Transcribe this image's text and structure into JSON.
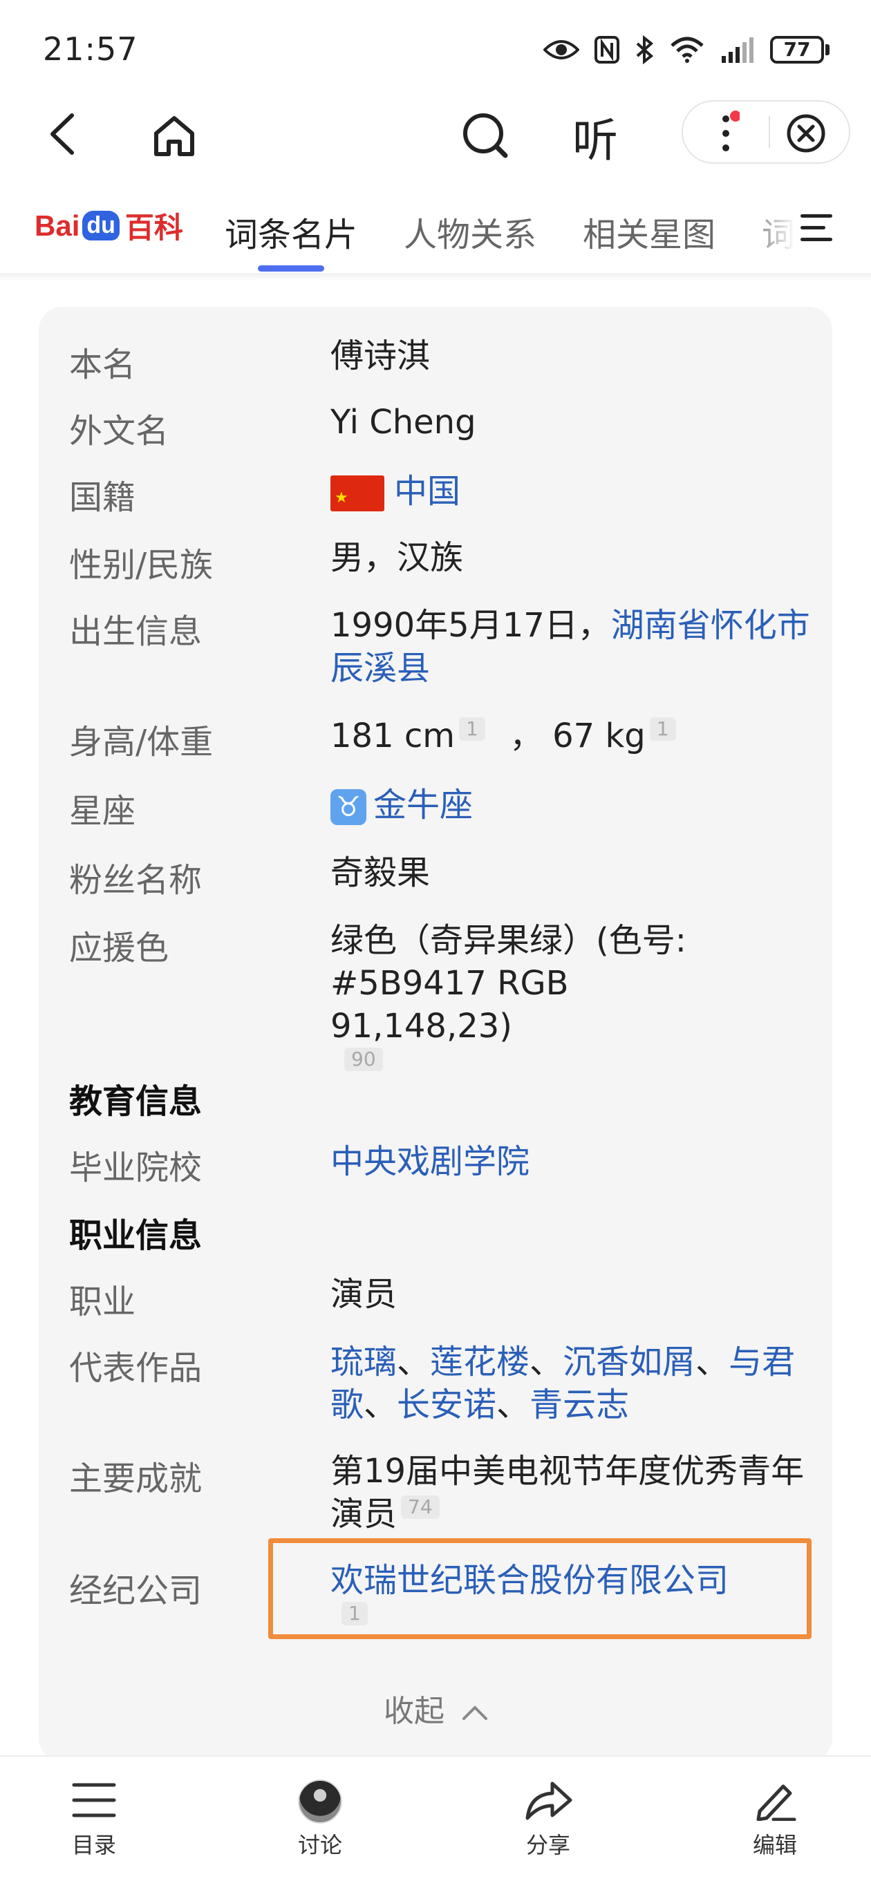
{
  "status_bar": {
    "time": "21:57",
    "battery": "77",
    "icons": [
      "eye-icon",
      "nfc-icon",
      "bluetooth-icon",
      "wifi-icon",
      "signal-icon"
    ]
  },
  "top_nav": {
    "back_icon": "back-arrow-icon",
    "home_icon": "home-icon",
    "search_icon": "search-icon",
    "listen_label": "听",
    "more_icon": "more-dots-icon",
    "close_icon": "close-icon",
    "notification_dot_color": "#f23a4a"
  },
  "header": {
    "logo": {
      "bai": "Bai",
      "du": "du",
      "baike": "百科"
    },
    "tabs": [
      {
        "label": "词条名片",
        "active": true
      },
      {
        "label": "人物关系",
        "active": false
      },
      {
        "label": "相关星图",
        "active": false
      },
      {
        "label": "词",
        "active": false
      }
    ],
    "menu_icon": "hamburger-menu-icon",
    "accent_color": "#4e6ef2"
  },
  "infobox": {
    "rows": [
      {
        "label": "本名",
        "value": "傅诗淇"
      },
      {
        "label": "外文名",
        "value": "Yi Cheng"
      },
      {
        "label": "国籍",
        "value": "中国"
      },
      {
        "label": "性别/民族",
        "value": "男，汉族"
      },
      {
        "label": "出生信息",
        "value_prefix": "1990年5月17日，",
        "value_link": "湖南省怀化市辰溪县"
      },
      {
        "label": "身高/体重",
        "height": "181 cm",
        "height_ref": "1",
        "sep": "，",
        "weight": "67 kg",
        "weight_ref": "1"
      },
      {
        "label": "星座",
        "value": "金牛座",
        "icon": "taurus-icon",
        "icon_glyph": "♉"
      },
      {
        "label": "粉丝名称",
        "value": "奇毅果"
      },
      {
        "label": "应援色",
        "value": "绿色（奇异果绿）(色号: #5B9417 RGB 91,148,23)",
        "ref": "90"
      }
    ],
    "education_heading": "教育信息",
    "education_rows": [
      {
        "label": "毕业院校",
        "value": "中央戏剧学院"
      }
    ],
    "career_heading": "职业信息",
    "career_rows": [
      {
        "label": "职业",
        "value": "演员"
      },
      {
        "label": "代表作品",
        "works": [
          "琉璃",
          "莲花楼",
          "沉香如屑",
          "与君歌",
          "长安诺",
          "青云志"
        ],
        "separator": "、"
      },
      {
        "label": "主要成就",
        "value": "第19届中美电视节年度优秀青年演员",
        "ref": "74"
      },
      {
        "label": "经纪公司",
        "value": "欢瑞世纪联合股份有限公司",
        "ref": "1"
      }
    ],
    "collapse_label": "收起",
    "link_color": "#2a5fb8",
    "highlight_color": "#f08c3c"
  },
  "bottom_bar": {
    "items": [
      {
        "label": "目录",
        "icon": "list-icon"
      },
      {
        "label": "讨论",
        "icon": "avatar"
      },
      {
        "label": "分享",
        "icon": "share-icon"
      },
      {
        "label": "编辑",
        "icon": "edit-icon"
      }
    ]
  }
}
